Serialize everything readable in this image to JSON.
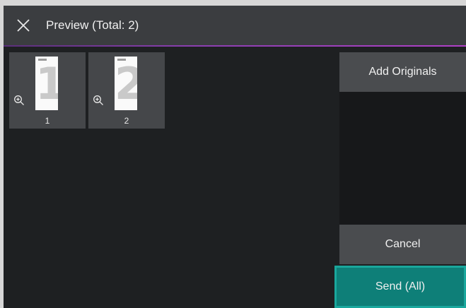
{
  "header": {
    "title": "Preview (Total: 2)",
    "close_icon": "close-icon"
  },
  "thumbnails": [
    {
      "label": "1",
      "page_glyph": "1",
      "zoom_icon": "zoom-in-icon"
    },
    {
      "label": "2",
      "page_glyph": "2",
      "zoom_icon": "zoom-in-icon"
    }
  ],
  "actions": {
    "add_originals": "Add Originals",
    "cancel": "Cancel",
    "send_all": "Send (All)"
  },
  "colors": {
    "accent": "#0e7f78",
    "header_underline": "#8a3fb0"
  }
}
